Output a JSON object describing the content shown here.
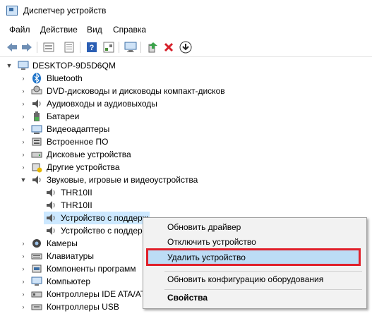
{
  "window": {
    "title": "Диспетчер устройств"
  },
  "menu": [
    "Файл",
    "Действие",
    "Вид",
    "Справка"
  ],
  "toolbar": {
    "icons": [
      "back-icon",
      "forward-icon",
      "properties-icon",
      "help-icon",
      "toggle-view-icon",
      "computer-scan-icon",
      "update-driver-icon",
      "uninstall-icon",
      "download-icon"
    ]
  },
  "tree": {
    "root": "DESKTOP-9D5D6QM",
    "nodes": [
      "Bluetooth",
      "DVD-дисководы и дисководы компакт-дисков",
      "Аудиовходы и аудиовыходы",
      "Батареи",
      "Видеоадаптеры",
      "Встроенное ПО",
      "Дисковые устройства",
      "Другие устройства",
      "Звуковые, игровые и видеоустройства",
      "THR10II",
      "THR10II",
      "Устройство с поддерж",
      "Устройство с поддерж",
      "Камеры",
      "Клавиатуры",
      "Компоненты программ",
      "Компьютер",
      "Контроллеры IDE ATA/AT",
      "Контроллеры USB"
    ],
    "selected_partial": "Устройство с поддержкой High Definition Audio"
  },
  "context_menu": {
    "items": [
      "Обновить драйвер",
      "Отключить устройство",
      "Удалить устройство",
      "Обновить конфигурацию оборудования",
      "Свойства"
    ]
  },
  "colors": {
    "highlight": "#e0202a",
    "selection": "#cce8ff",
    "menu_bg": "#f2f2f2"
  }
}
